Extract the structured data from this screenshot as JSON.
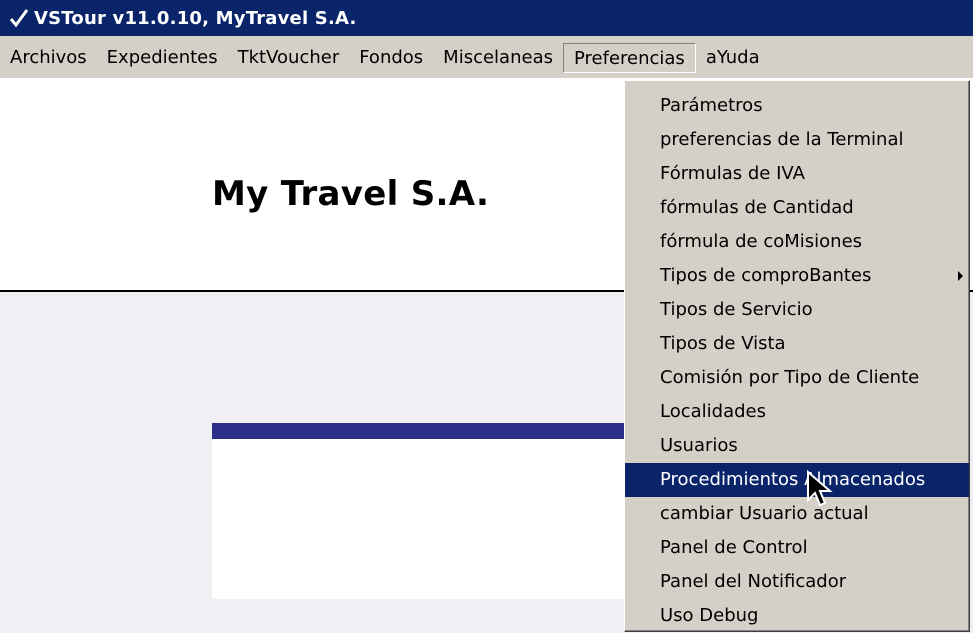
{
  "window": {
    "title": "VSTour v11.0.10, MyTravel S.A.",
    "icon": "check-icon"
  },
  "menubar": {
    "items": [
      {
        "label": "Archivos"
      },
      {
        "label": "Expedientes"
      },
      {
        "label": "TktVoucher"
      },
      {
        "label": "Fondos"
      },
      {
        "label": "Miscelaneas"
      },
      {
        "label": "Preferencias",
        "active": true
      },
      {
        "label": "aYuda"
      }
    ]
  },
  "banner": {
    "company_name": "My Travel S.A."
  },
  "preferencias_menu": {
    "items": [
      {
        "label": "Parámetros"
      },
      {
        "label": "preferencias de la Terminal"
      },
      {
        "label": "Fórmulas de IVA"
      },
      {
        "label": "fórmulas de Cantidad"
      },
      {
        "label": "fórmula de coMisiones"
      },
      {
        "label": "Tipos de comproBantes",
        "has_submenu": true
      },
      {
        "label": "Tipos de Servicio"
      },
      {
        "label": "Tipos de Vista"
      },
      {
        "label": "Comisión por Tipo de Cliente"
      },
      {
        "label": "Localidades"
      },
      {
        "label": "Usuarios"
      },
      {
        "label": "Procedimientos Almacenados",
        "selected": true
      },
      {
        "label": "cambiar Usuario actual"
      },
      {
        "label": "Panel de Control"
      },
      {
        "label": "Panel del Notificador"
      },
      {
        "label": "Uso Debug"
      }
    ]
  },
  "colors": {
    "titlebar": "#0a246a",
    "menu_selection": "#0a246a",
    "panel_header": "#2b2f8a",
    "chrome": "#d4d0c8"
  }
}
